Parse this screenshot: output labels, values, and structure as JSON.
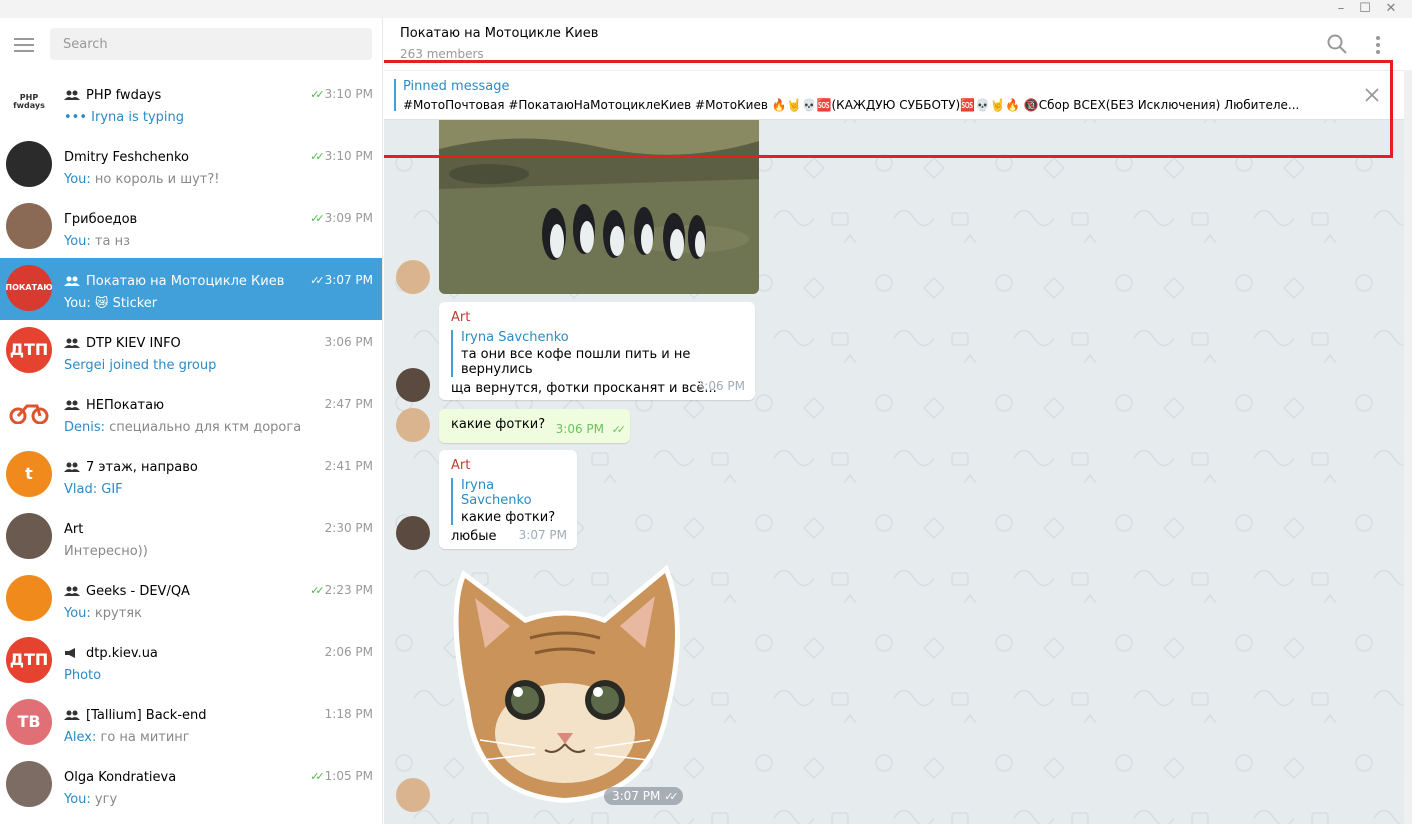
{
  "window": {
    "minimize": "–",
    "maximize": "☐",
    "close": "✕"
  },
  "sidebar": {
    "search_placeholder": "Search",
    "chats": [
      {
        "name": "PHP fwdays",
        "kind": "group",
        "time": "3:10 PM",
        "read": true,
        "sender": "",
        "preview": "••• Iryna is typing",
        "typing": true,
        "avatar_text": "PHP fwdays",
        "avatar_color": "#ffffff"
      },
      {
        "name": "Dmitry Feshchenko",
        "kind": "user",
        "time": "3:10 PM",
        "read": true,
        "sender": "You:",
        "preview": " но король и шут?!",
        "avatar_text": "",
        "avatar_color": "#2b2b2b"
      },
      {
        "name": "Грибоедов",
        "kind": "user",
        "time": "3:09 PM",
        "read": true,
        "sender": "You:",
        "preview": " та нз",
        "avatar_text": "",
        "avatar_color": "#8a6a55"
      },
      {
        "name": "Покатаю на Мотоцикле Киев",
        "kind": "group",
        "time": "3:07 PM",
        "read": true,
        "sender": "You:",
        "preview": " 😿 Sticker",
        "avatar_text": "ПОКАТАЮ",
        "avatar_color": "#d93a2f",
        "active": true
      },
      {
        "name": "DTP KIEV INFO",
        "kind": "group",
        "time": "3:06 PM",
        "read": false,
        "sender": "",
        "preview": "Sergei joined the group",
        "service": true,
        "avatar_text": "ДТП",
        "avatar_color": "#e5432f"
      },
      {
        "name": "НЕПокатаю",
        "kind": "group",
        "time": "2:47 PM",
        "read": false,
        "sender": "Denis:",
        "preview": " специально для ктм дорога",
        "avatar_text": "",
        "avatar_color": "#ffffff"
      },
      {
        "name": "7 этаж, направо",
        "kind": "group",
        "time": "2:41 PM",
        "read": false,
        "sender": "Vlad:",
        "preview": " GIF",
        "media": true,
        "avatar_text": "t",
        "avatar_color": "#f08a1c"
      },
      {
        "name": "Art",
        "kind": "user",
        "time": "2:30 PM",
        "read": false,
        "sender": "",
        "preview": "Интересно))",
        "avatar_text": "",
        "avatar_color": "#6b5a4f"
      },
      {
        "name": "Geeks - DEV/QA",
        "kind": "group",
        "time": "2:23 PM",
        "read": true,
        "sender": "You:",
        "preview": " крутяк",
        "avatar_text": "",
        "avatar_color": "#f08a1c"
      },
      {
        "name": "dtp.kiev.ua",
        "kind": "channel",
        "time": "2:06 PM",
        "read": false,
        "sender": "",
        "preview": "Photo",
        "media": true,
        "avatar_text": "ДТП",
        "avatar_color": "#e5432f"
      },
      {
        "name": "[Tallium] Back-end",
        "kind": "group",
        "time": "1:18 PM",
        "read": false,
        "sender": "Alex:",
        "preview": " го на митинг",
        "avatar_text": "TB",
        "avatar_color": "#e17076"
      },
      {
        "name": "Olga Kondratieva",
        "kind": "user",
        "time": "1:05 PM",
        "read": true,
        "sender": "You:",
        "preview": " угу",
        "avatar_text": "",
        "avatar_color": "#7d6c63"
      }
    ]
  },
  "header": {
    "title": "Покатаю на Мотоцикле Киев",
    "subtitle": "263 members"
  },
  "pinned": {
    "label": "Pinned message",
    "text": "#МотоПочтовая #ПокатаюНаМотоциклеКиев #МотоКиев 🔥🤘💀🆘(КАЖДУЮ СУББОТУ)🆘💀🤘🔥 🔞Сбор ВСЕХ(БЕЗ Исключения) Любителе..."
  },
  "messages": {
    "m1": {
      "from": "Art",
      "reply_name": "Iryna Savchenko",
      "reply_text": "та они все кофе пошли пить и не вернулись",
      "text": "ща вернутся, фотки просканят и всё...",
      "time": "3:06 PM"
    },
    "m2": {
      "text": "какие фотки?",
      "time": "3:06 PM"
    },
    "m3": {
      "from": "Art",
      "reply_name": "Iryna Savchenko",
      "reply_text": "какие фотки?",
      "text": "любые",
      "time": "3:07 PM"
    },
    "sticker_time": "3:07 PM"
  },
  "colors": {
    "accent": "#419fd9",
    "link": "#2a8bc6",
    "read_check": "#4fb948",
    "highlight": "#e81c23",
    "chat_bg": "#e6ebee",
    "out_bubble": "#effdde"
  }
}
